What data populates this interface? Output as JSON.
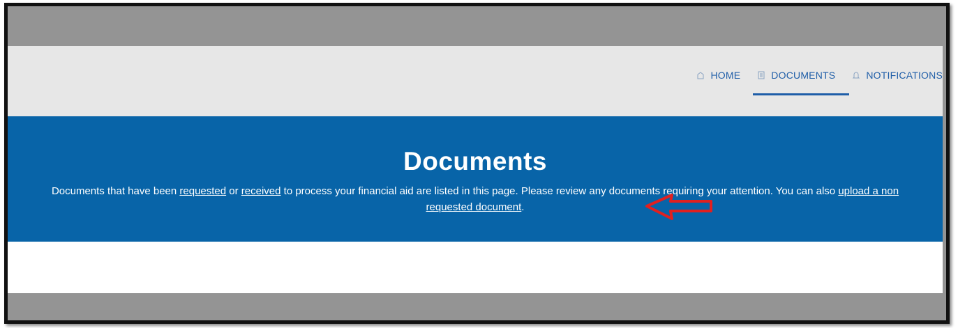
{
  "nav": {
    "items": [
      {
        "label": "HOME",
        "icon": "home-icon"
      },
      {
        "label": "DOCUMENTS",
        "icon": "document-icon",
        "active": true
      },
      {
        "label": "NOTIFICATIONS",
        "icon": "bell-icon"
      }
    ]
  },
  "banner": {
    "title": "Documents",
    "text_1": "Documents that have been ",
    "link_requested": "requested",
    "text_2": " or ",
    "link_received": "received",
    "text_3": " to process your financial aid are listed in this page. Please review any documents requiring your attention. You can also ",
    "link_upload": "upload a non requested document",
    "text_4": "."
  },
  "colors": {
    "banner_bg": "#0864a8",
    "nav_text": "#1f5ea8",
    "arrow": "#e02020",
    "frame_gray": "#949494"
  }
}
